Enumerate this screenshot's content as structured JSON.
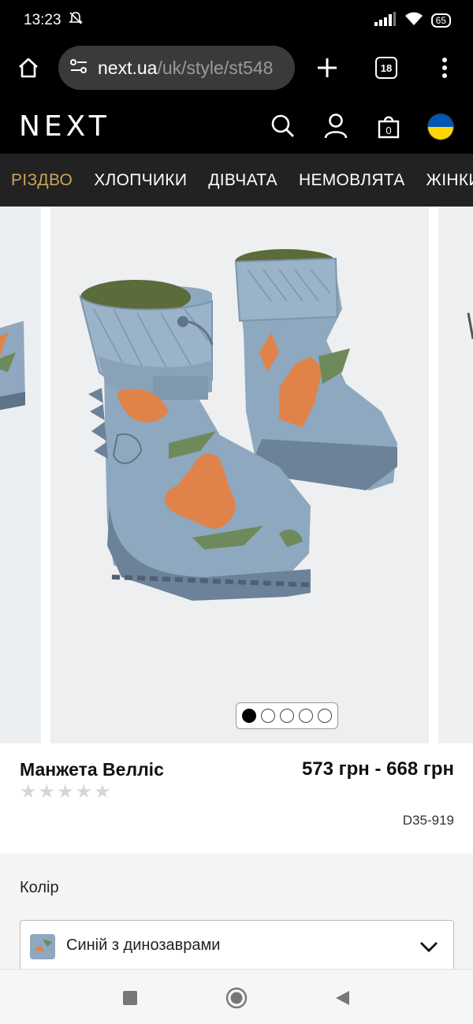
{
  "status_bar": {
    "time": "13:23",
    "battery": "65",
    "icons": [
      "do-not-disturb-off-icon",
      "signal-icon",
      "wifi-icon",
      "battery-icon"
    ]
  },
  "browser": {
    "url_domain": "next.ua",
    "url_path": "/uk/style/st548",
    "tab_count": "18",
    "icons": [
      "home-icon",
      "site-settings-icon",
      "plus-icon",
      "tabs-icon",
      "more-vert-icon"
    ]
  },
  "site_header": {
    "logo": "NEXT",
    "bag_count": "0",
    "icons": [
      "search-icon",
      "account-icon",
      "bag-icon",
      "ukraine-flag-icon"
    ]
  },
  "categories": [
    {
      "label": "РІЗДВО",
      "highlight": true
    },
    {
      "label": "ХЛОПЧИКИ",
      "highlight": false
    },
    {
      "label": "ДІВЧАТА",
      "highlight": false
    },
    {
      "label": "НЕМОВЛЯТА",
      "highlight": false
    },
    {
      "label": "ЖІНКИ",
      "highlight": false
    }
  ],
  "gallery": {
    "dots_total": 5,
    "active_index": 0
  },
  "product": {
    "title": "Манжета Велліс",
    "price": "573 грн - 668 грн",
    "sku": "D35-919",
    "rating": 0,
    "stars_total": 5
  },
  "options": {
    "colour_label": "Колір",
    "colour_value": "Синій з динозаврами"
  },
  "nav_bar": {
    "icons": [
      "recents-square-icon",
      "home-circle-icon",
      "back-triangle-icon"
    ]
  },
  "colors": {
    "header_bg": "#000000",
    "nav_bg": "#222222",
    "highlight": "#c9a55a",
    "boot_blue": "#8fa8c0"
  }
}
